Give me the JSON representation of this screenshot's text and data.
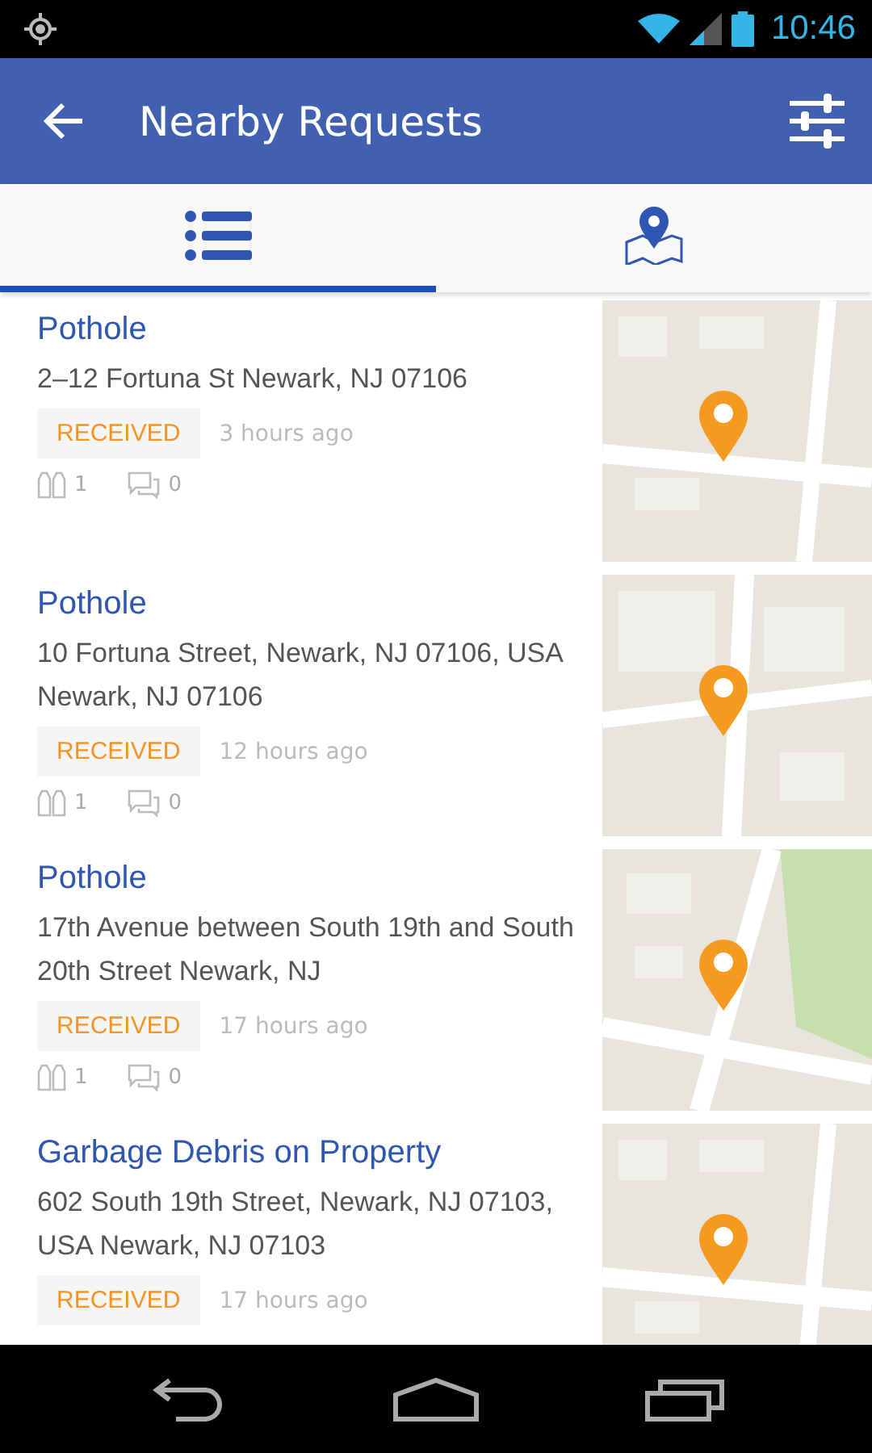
{
  "status_bar": {
    "time": "10:46"
  },
  "app_bar": {
    "title": "Nearby Requests"
  },
  "tabs": [
    {
      "kind": "list",
      "selected": true
    },
    {
      "kind": "map",
      "selected": false
    }
  ],
  "requests": [
    {
      "title": "Pothole",
      "address": "2–12 Fortuna St Newark, NJ 07106",
      "status": "RECEIVED",
      "time": "3 hours ago",
      "votes": "1",
      "comments": "0"
    },
    {
      "title": "Pothole",
      "address": "10 Fortuna Street, Newark, NJ 07106, USA Newark, NJ 07106",
      "status": "RECEIVED",
      "time": "12 hours ago",
      "votes": "1",
      "comments": "0"
    },
    {
      "title": "Pothole",
      "address": "17th Avenue between South 19th and South 20th Street Newark, NJ",
      "status": "RECEIVED",
      "time": "17 hours ago",
      "votes": "1",
      "comments": "0"
    },
    {
      "title": "Garbage Debris on Property",
      "address": "602 South 19th Street, Newark, NJ 07103, USA Newark, NJ 07103",
      "status": "RECEIVED",
      "time": "17 hours ago"
    }
  ]
}
